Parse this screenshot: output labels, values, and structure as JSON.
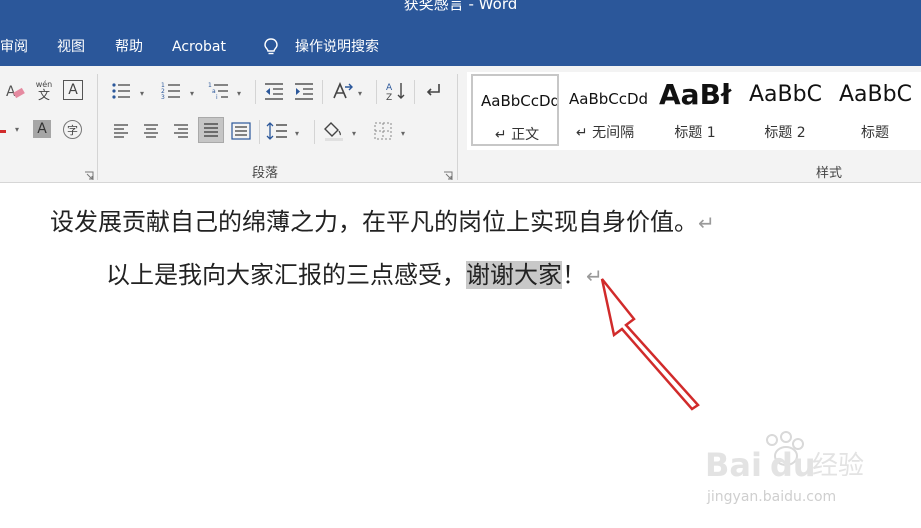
{
  "window": {
    "title": "获奖感言 - Word"
  },
  "menu": {
    "review": "审阅",
    "view": "视图",
    "help": "帮助",
    "acrobat": "Acrobat",
    "tell_me": "操作说明搜索"
  },
  "ribbon": {
    "paragraph_group": "段落",
    "styles_group": "样式",
    "styles": [
      {
        "sample": "AaBbCcDd",
        "name": "↵ 正文"
      },
      {
        "sample": "AaBbCcDd",
        "name": "↵ 无间隔"
      },
      {
        "sample": "AaBł",
        "name": "标题 1"
      },
      {
        "sample": "AaBbC",
        "name": "标题 2"
      },
      {
        "sample": "AaBbC",
        "name": "标题"
      }
    ],
    "font_icons": {
      "phonetic": "wén",
      "phonetic_char": "文",
      "char_border": "A",
      "shading": "A",
      "enclose": "字"
    }
  },
  "document": {
    "line1": "设发展贡献自己的绵薄之力，在平凡的岗位上实现自身价值。",
    "line2_before": "以上是我向大家汇报的三点感受，",
    "line2_selected": "谢谢大家",
    "line2_after": "！",
    "para_mark": "↵"
  },
  "watermark": {
    "brand": "Baidu经验",
    "url": "jingyan.baidu.com"
  },
  "colors": {
    "titlebar": "#2b579a",
    "ribbon": "#f3f3f3",
    "selection": "#c8c8c8",
    "arrow": "#d12b2b"
  }
}
